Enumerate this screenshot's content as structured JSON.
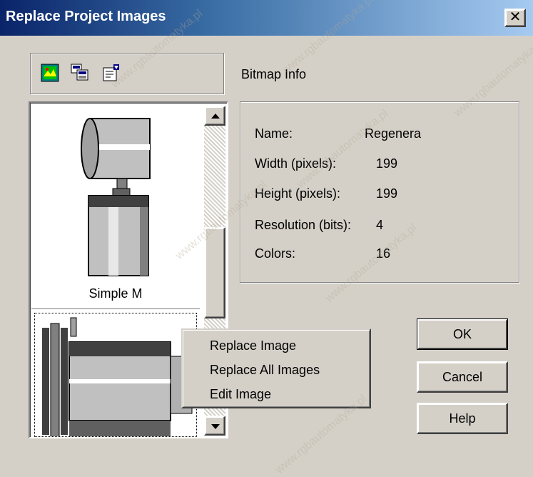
{
  "window": {
    "title": "Replace Project Images",
    "close_glyph": "✕"
  },
  "toolbar": {
    "icons": [
      "replace-image-icon",
      "replace-all-icon",
      "properties-icon"
    ]
  },
  "bitmap_info": {
    "label": "Bitmap Info",
    "rows": [
      {
        "key": "Name:",
        "value": "Regenera"
      },
      {
        "key": "Width (pixels):",
        "value": "199"
      },
      {
        "key": "Height (pixels):",
        "value": "199"
      },
      {
        "key": "Resolution (bits):",
        "value": "4"
      },
      {
        "key": "Colors:",
        "value": "16"
      }
    ]
  },
  "image_list": {
    "items": [
      {
        "label": "Simple M"
      },
      {
        "label": ""
      }
    ]
  },
  "buttons": {
    "ok": "OK",
    "cancel": "Cancel",
    "help": "Help"
  },
  "context_menu": {
    "items": [
      "Replace Image",
      "Replace All Images",
      "Edit Image"
    ]
  },
  "watermark": "www.rgbautomatyka.pl"
}
